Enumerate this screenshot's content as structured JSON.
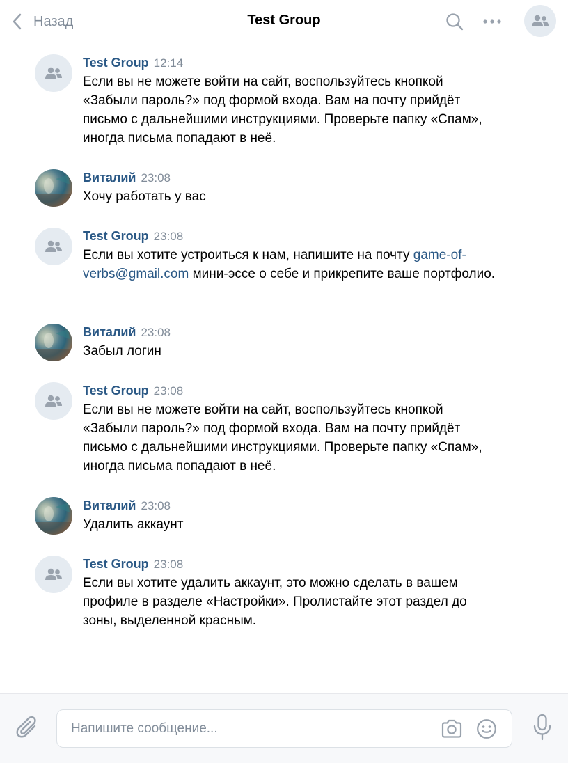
{
  "header": {
    "back_label": "Назад",
    "title": "Test Group",
    "icons": {
      "back": "chevron-left-icon",
      "search": "search-icon",
      "more": "more-horizontal-icon",
      "avatar": "group-icon"
    }
  },
  "colors": {
    "accent": "#2a5885",
    "muted": "#818c99",
    "avatar_bg": "#e5ebf1",
    "icon": "#99a2ad"
  },
  "messages": [
    {
      "author": "Test Group",
      "time": "12:14",
      "avatar": "group-icon",
      "parts": [
        "Если вы не можете войти на сайт, воспользуйтесь кнопкой «Забыли пароль?» под формой входа. Вам на почту прийдёт письмо с дальнейшими инструкциями. Проверьте папку «Спам», иногда письма попадают в неё."
      ]
    },
    {
      "author": "Виталий",
      "time": "23:08",
      "avatar": "user-photo",
      "parts": [
        "Хочу работать у вас"
      ]
    },
    {
      "author": "Test Group",
      "time": "23:08",
      "avatar": "group-icon",
      "parts": [
        "Если вы хотите устроиться к нам, напишите на почту ",
        "game-of-verbs@gmail.com",
        " мини-эссе о себе и прикрепите ваше портфолио."
      ]
    },
    {
      "author": "Виталий",
      "time": "23:08",
      "avatar": "user-photo",
      "parts": [
        "Забыл логин"
      ]
    },
    {
      "author": "Test Group",
      "time": "23:08",
      "avatar": "group-icon",
      "parts": [
        "Если вы не можете войти на сайт, воспользуйтесь кнопкой «Забыли пароль?» под формой входа. Вам на почту прийдёт письмо с дальнейшими инструкциями. Проверьте папку «Спам», иногда письма попадают в неё."
      ]
    },
    {
      "author": "Виталий",
      "time": "23:08",
      "avatar": "user-photo",
      "parts": [
        "Удалить аккаунт"
      ]
    },
    {
      "author": "Test Group",
      "time": "23:08",
      "avatar": "group-icon",
      "parts": [
        "Если вы хотите удалить аккаунт, это можно сделать в вашем профиле в разделе «Настройки». Пролистайте этот раздел до зоны, выделенной красным."
      ]
    }
  ],
  "composer": {
    "placeholder": "Напишите сообщение...",
    "value": "",
    "icons": {
      "attach": "paperclip-icon",
      "camera": "camera-icon",
      "emoji": "smile-icon",
      "voice": "microphone-icon"
    }
  }
}
